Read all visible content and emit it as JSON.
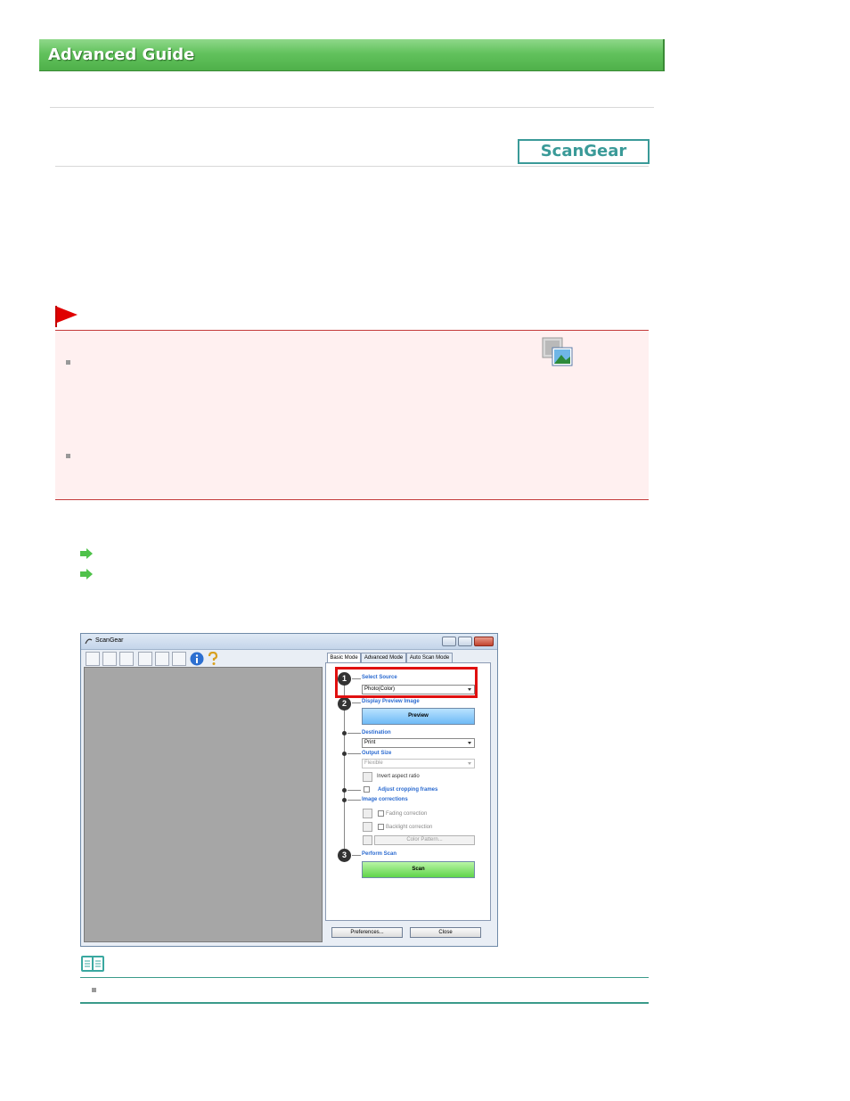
{
  "header": {
    "title": "Advanced Guide"
  },
  "scangear_button": {
    "label": "ScanGear"
  },
  "screenshot": {
    "window_title": "ScanGear",
    "tabs": [
      {
        "label": "Basic Mode",
        "active": true
      },
      {
        "label": "Advanced Mode",
        "active": false
      },
      {
        "label": "Auto Scan Mode",
        "active": false
      }
    ],
    "steps": {
      "select_source": {
        "number": "1",
        "label": "Select Source",
        "value": "Photo(Color)"
      },
      "display_preview": {
        "number": "2",
        "label": "Display Preview Image",
        "button": "Preview"
      },
      "destination": {
        "label": "Destination",
        "value": "Print"
      },
      "output_size": {
        "label": "Output Size",
        "value": "Flexible"
      },
      "invert_aspect": "Invert aspect ratio",
      "adjust_cropping": "Adjust cropping frames",
      "image_corrections": {
        "label": "Image corrections",
        "fading": "Fading correction",
        "backlight": "Backlight correction",
        "color_pattern": "Color Pattern..."
      },
      "perform_scan": {
        "number": "3",
        "label": "Perform Scan",
        "button": "Scan"
      }
    },
    "footer": {
      "preferences": "Preferences...",
      "close": "Close"
    }
  },
  "colors": {
    "header_green": "#62c25d",
    "teal": "#3a9a98",
    "important_red": "#c43a3a",
    "important_bg": "#fff0f0",
    "highlight_red": "#e01010"
  }
}
